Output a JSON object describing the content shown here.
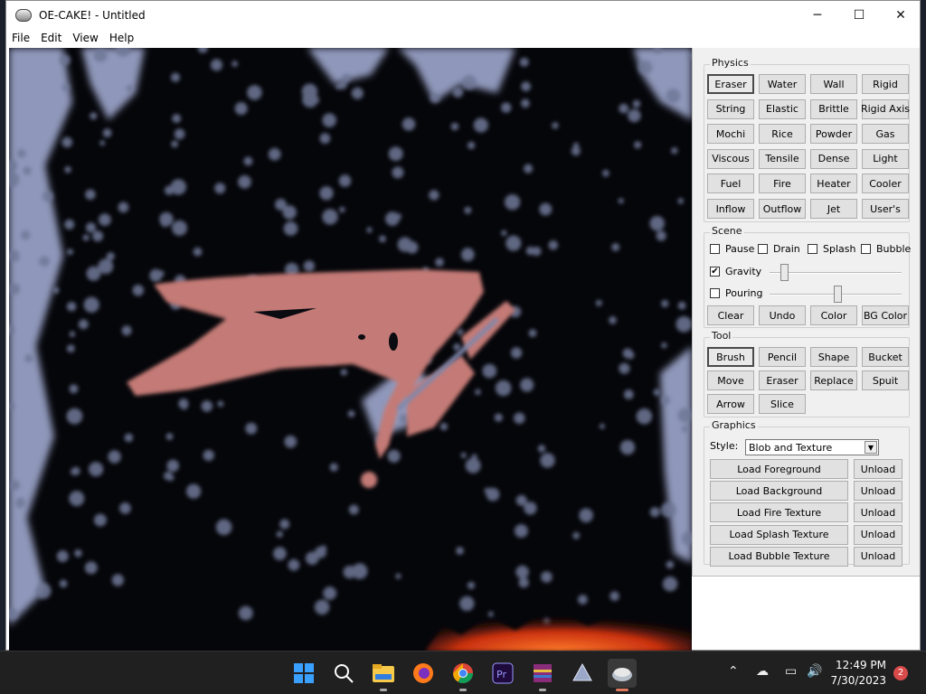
{
  "window": {
    "title": "OE-CAKE! - Untitled",
    "minimize": "─",
    "maximize": "☐",
    "close": "✕"
  },
  "menu": [
    "File",
    "Edit",
    "View",
    "Help"
  ],
  "physics": {
    "label": "Physics",
    "buttons": [
      [
        "Eraser",
        "Water",
        "Wall",
        "Rigid"
      ],
      [
        "String",
        "Elastic",
        "Brittle",
        "Rigid Axis"
      ],
      [
        "Mochi",
        "Rice",
        "Powder",
        "Gas"
      ],
      [
        "Viscous",
        "Tensile",
        "Dense",
        "Light"
      ],
      [
        "Fuel",
        "Fire",
        "Heater",
        "Cooler"
      ],
      [
        "Inflow",
        "Outflow",
        "Jet",
        "User's"
      ]
    ],
    "selected": "Eraser"
  },
  "scene": {
    "label": "Scene",
    "checks": [
      {
        "label": "Pause",
        "checked": false
      },
      {
        "label": "Drain",
        "checked": false
      },
      {
        "label": "Splash",
        "checked": false
      },
      {
        "label": "Bubble",
        "checked": false
      }
    ],
    "gravity": {
      "label": "Gravity",
      "checked": true,
      "level": 0.09
    },
    "pouring": {
      "label": "Pouring",
      "checked": false,
      "level": 0.52
    },
    "buttons": [
      "Clear",
      "Undo",
      "Color",
      "BG Color"
    ]
  },
  "tool": {
    "label": "Tool",
    "buttons": [
      [
        "Brush",
        "Pencil",
        "Shape",
        "Bucket"
      ],
      [
        "Move",
        "Eraser",
        "Replace",
        "Spuit"
      ],
      [
        "Arrow",
        "Slice"
      ]
    ],
    "selected": "Brush"
  },
  "graphics": {
    "label": "Graphics",
    "style_label": "Style:",
    "style_value": "Blob and Texture",
    "loads": [
      {
        "label": "Load Foreground",
        "unload": "Unload"
      },
      {
        "label": "Load Background",
        "unload": "Unload"
      },
      {
        "label": "Load Fire Texture",
        "unload": "Unload"
      },
      {
        "label": "Load Splash Texture",
        "unload": "Unload"
      },
      {
        "label": "Load Bubble Texture",
        "unload": "Unload"
      }
    ]
  },
  "taskbar": {
    "time": "12:49 PM",
    "date": "7/30/2023",
    "notifications": "2",
    "apps": [
      "start-icon",
      "search-icon",
      "file-explorer-icon",
      "firefox-icon",
      "chrome-icon",
      "premiere-icon",
      "winrar-icon",
      "inkscape-icon",
      "oe-cake-icon"
    ]
  },
  "colors": {
    "panel_bg": "#f0f0f0",
    "canvas_bg": "#05060a",
    "particle": "#9ea6c8",
    "blob": "#c47a76",
    "fire": "#e0401a",
    "taskbar": "#202020"
  }
}
